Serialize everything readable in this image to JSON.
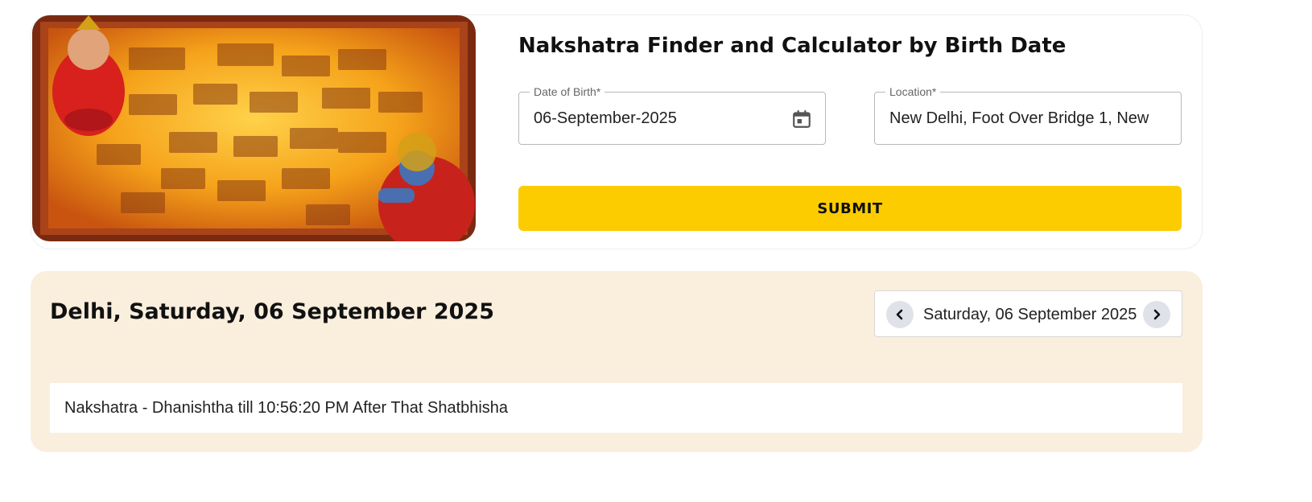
{
  "form": {
    "title": "Nakshatra Finder and Calculator by Birth Date",
    "dob": {
      "label": "Date of Birth*",
      "value": "06-September-2025",
      "icon": "calendar-icon"
    },
    "location": {
      "label": "Location*",
      "value": "New Delhi, Foot Over Bridge 1, New"
    },
    "submit_label": "SUBMIT"
  },
  "result": {
    "title": "Delhi, Saturday, 06 September 2025",
    "nav": {
      "date": "Saturday, 06 September 2025",
      "prev_icon": "chevron-left-icon",
      "next_icon": "chevron-right-icon"
    },
    "nakshatra_text": "Nakshatra - Dhanishtha till 10:56:20 PM After That Shatbhisha"
  },
  "colors": {
    "accent": "#fccc00",
    "panel": "#faeedd",
    "hero_orange": "#f39a14",
    "hero_border": "#9c3b17"
  }
}
